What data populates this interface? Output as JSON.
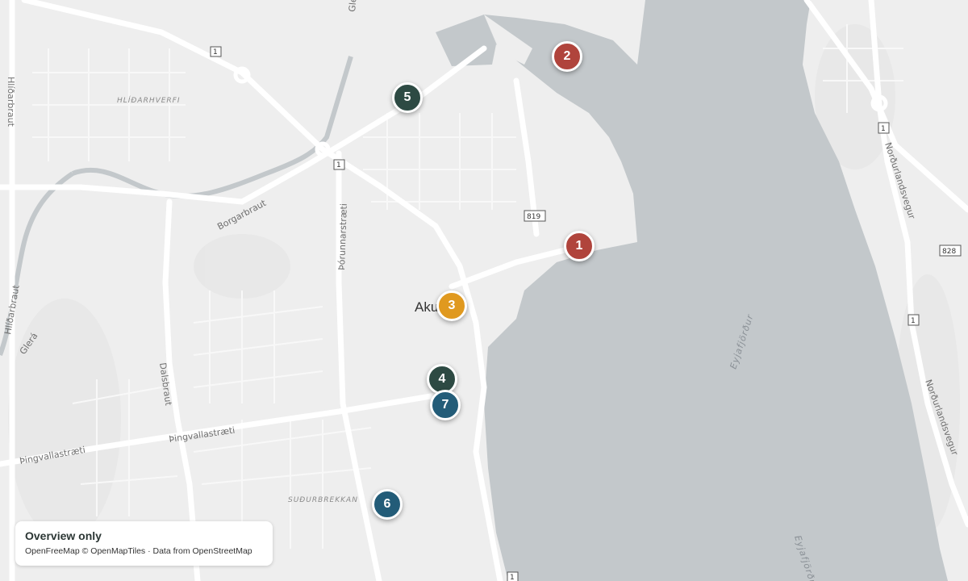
{
  "map": {
    "city_label": "Akureyri",
    "fjord_label": "Eyjafjörður",
    "districts": [
      "HLÍÐARHVERFI",
      "SUÐURBREKKAN"
    ],
    "roads": {
      "hlidarbraut": "Hlíðarbraut",
      "borgarbraut": "Borgarbraut",
      "thorunnarstraeti": "Þórunnarstræti",
      "dalsbraut": "Dalsbraut",
      "thingvallastraeti": "Þingvallastræti",
      "nordurlandsvegur": "Norðurlandsvegur",
      "glerargata": "Glerárgata",
      "glera": "Glerá"
    },
    "route_shields": [
      "1",
      "819",
      "828"
    ],
    "colors": {
      "land": "#eeeeee",
      "water": "#c3c8cb",
      "road": "#ffffff"
    }
  },
  "markers": [
    {
      "label": "1",
      "color": "#b0443c"
    },
    {
      "label": "2",
      "color": "#b0443c"
    },
    {
      "label": "3",
      "color": "#e0991f"
    },
    {
      "label": "4",
      "color": "#2d4a43"
    },
    {
      "label": "5",
      "color": "#2d4a43"
    },
    {
      "label": "6",
      "color": "#235c78"
    },
    {
      "label": "7",
      "color": "#235c78"
    }
  ],
  "attribution": {
    "title": "Overview only",
    "credits": "OpenFreeMap © OpenMapTiles · Data from OpenStreetMap"
  }
}
